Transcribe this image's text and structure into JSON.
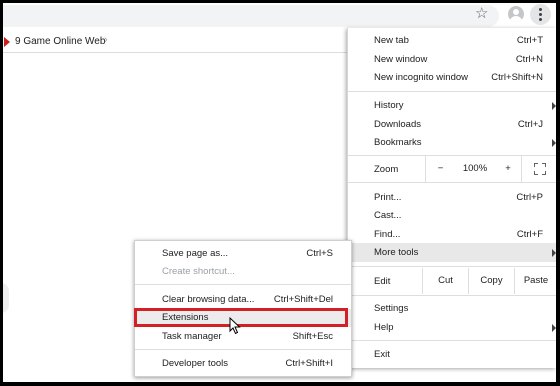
{
  "main_menu": {
    "new_tab": {
      "label": "New tab",
      "shortcut": "Ctrl+T"
    },
    "new_window": {
      "label": "New window",
      "shortcut": "Ctrl+N"
    },
    "new_incognito": {
      "label": "New incognito window",
      "shortcut": "Ctrl+Shift+N"
    },
    "history": {
      "label": "History"
    },
    "downloads": {
      "label": "Downloads",
      "shortcut": "Ctrl+J"
    },
    "bookmarks": {
      "label": "Bookmarks"
    },
    "zoom": {
      "label": "Zoom",
      "minus": "−",
      "value": "100%",
      "plus": "+"
    },
    "print": {
      "label": "Print...",
      "shortcut": "Ctrl+P"
    },
    "cast": {
      "label": "Cast..."
    },
    "find": {
      "label": "Find...",
      "shortcut": "Ctrl+F"
    },
    "more_tools": {
      "label": "More tools"
    },
    "edit": {
      "label": "Edit",
      "cut": "Cut",
      "copy": "Copy",
      "paste": "Paste"
    },
    "settings": {
      "label": "Settings"
    },
    "help": {
      "label": "Help"
    },
    "exit": {
      "label": "Exit"
    }
  },
  "more_tools_menu": {
    "save_page": {
      "label": "Save page as...",
      "shortcut": "Ctrl+S"
    },
    "create_shortcut": {
      "label": "Create shortcut..."
    },
    "clear_browsing": {
      "label": "Clear browsing data...",
      "shortcut": "Ctrl+Shift+Del"
    },
    "extensions": {
      "label": "Extensions"
    },
    "task_manager": {
      "label": "Task manager",
      "shortcut": "Shift+Esc"
    },
    "developer_tools": {
      "label": "Developer tools",
      "shortcut": "Ctrl+Shift+I"
    }
  },
  "bookmarks_bar": {
    "item_label": "9 Game Online Web",
    "more_indicator": "›"
  },
  "toolbar": {
    "star_icon": "☆"
  },
  "colors": {
    "highlight_box": "#d32027",
    "bookmark_icon": "#c5221f"
  }
}
